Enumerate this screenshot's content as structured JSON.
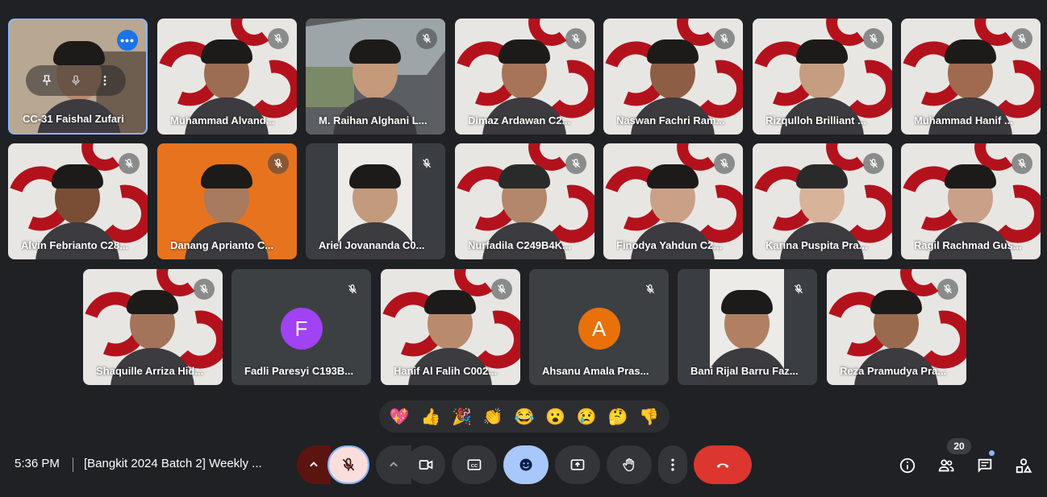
{
  "participants": [
    {
      "name": "CC-31 Faishal Zufari"
    },
    {
      "name": "Muhammad Alvand..."
    },
    {
      "name": "M. Raihan Alghani L..."
    },
    {
      "name": "Dimaz Ardawan C2..."
    },
    {
      "name": "Naswan Fachri Ram..."
    },
    {
      "name": "Rizqulloh Brilliant ..."
    },
    {
      "name": "Muhammad Hanif ..."
    },
    {
      "name": "Alvin Febrianto C28..."
    },
    {
      "name": "Danang Aprianto C..."
    },
    {
      "name": "Ariel Jovananda C0..."
    },
    {
      "name": "Nurfadila C249B4K..."
    },
    {
      "name": "Finodya Yahdun C2..."
    },
    {
      "name": "Karina Puspita Pra..."
    },
    {
      "name": "Ragil Rachmad Gus..."
    },
    {
      "name": "Shaquille Arriza Hid..."
    },
    {
      "name": "Fadli Paresyi C193B...",
      "initial": "F",
      "color": "#a142f4"
    },
    {
      "name": "Hanif Al Falih C002..."
    },
    {
      "name": "Ahsanu Amala Pras...",
      "initial": "A",
      "color": "#e8710a"
    },
    {
      "name": "Bani Rijal Barru Faz..."
    },
    {
      "name": "Reza Pramudya Pra..."
    }
  ],
  "self_tile_more": "•••",
  "reactions": [
    "💖",
    "👍",
    "🎉",
    "👏",
    "😂",
    "😮",
    "😢",
    "🤔",
    "👎"
  ],
  "bottom": {
    "time": "5:36 PM",
    "meeting_title": "[Bangkit 2024 Batch 2] Weekly ...",
    "participant_count": "20"
  },
  "colors": {
    "accent": "#8ab4f8",
    "end_call": "#dc362e",
    "mic_off_bg": "#f9dedc",
    "brand_red": "#b3121d"
  }
}
